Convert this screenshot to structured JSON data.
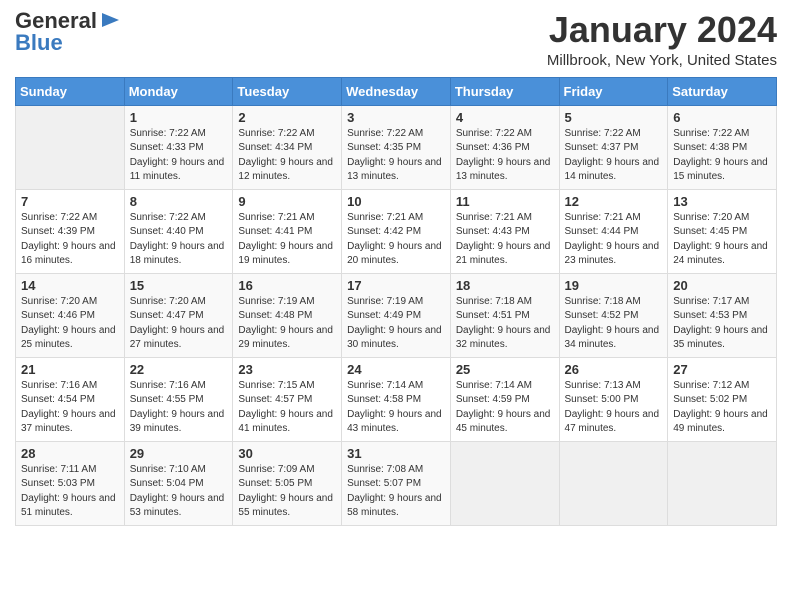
{
  "header": {
    "logo_general": "General",
    "logo_blue": "Blue",
    "month_title": "January 2024",
    "location": "Millbrook, New York, United States"
  },
  "days_of_week": [
    "Sunday",
    "Monday",
    "Tuesday",
    "Wednesday",
    "Thursday",
    "Friday",
    "Saturday"
  ],
  "weeks": [
    [
      {
        "num": "",
        "empty": true
      },
      {
        "num": "1",
        "sunrise": "7:22 AM",
        "sunset": "4:33 PM",
        "daylight": "9 hours and 11 minutes."
      },
      {
        "num": "2",
        "sunrise": "7:22 AM",
        "sunset": "4:34 PM",
        "daylight": "9 hours and 12 minutes."
      },
      {
        "num": "3",
        "sunrise": "7:22 AM",
        "sunset": "4:35 PM",
        "daylight": "9 hours and 13 minutes."
      },
      {
        "num": "4",
        "sunrise": "7:22 AM",
        "sunset": "4:36 PM",
        "daylight": "9 hours and 13 minutes."
      },
      {
        "num": "5",
        "sunrise": "7:22 AM",
        "sunset": "4:37 PM",
        "daylight": "9 hours and 14 minutes."
      },
      {
        "num": "6",
        "sunrise": "7:22 AM",
        "sunset": "4:38 PM",
        "daylight": "9 hours and 15 minutes."
      }
    ],
    [
      {
        "num": "7",
        "sunrise": "7:22 AM",
        "sunset": "4:39 PM",
        "daylight": "9 hours and 16 minutes."
      },
      {
        "num": "8",
        "sunrise": "7:22 AM",
        "sunset": "4:40 PM",
        "daylight": "9 hours and 18 minutes."
      },
      {
        "num": "9",
        "sunrise": "7:21 AM",
        "sunset": "4:41 PM",
        "daylight": "9 hours and 19 minutes."
      },
      {
        "num": "10",
        "sunrise": "7:21 AM",
        "sunset": "4:42 PM",
        "daylight": "9 hours and 20 minutes."
      },
      {
        "num": "11",
        "sunrise": "7:21 AM",
        "sunset": "4:43 PM",
        "daylight": "9 hours and 21 minutes."
      },
      {
        "num": "12",
        "sunrise": "7:21 AM",
        "sunset": "4:44 PM",
        "daylight": "9 hours and 23 minutes."
      },
      {
        "num": "13",
        "sunrise": "7:20 AM",
        "sunset": "4:45 PM",
        "daylight": "9 hours and 24 minutes."
      }
    ],
    [
      {
        "num": "14",
        "sunrise": "7:20 AM",
        "sunset": "4:46 PM",
        "daylight": "9 hours and 25 minutes."
      },
      {
        "num": "15",
        "sunrise": "7:20 AM",
        "sunset": "4:47 PM",
        "daylight": "9 hours and 27 minutes."
      },
      {
        "num": "16",
        "sunrise": "7:19 AM",
        "sunset": "4:48 PM",
        "daylight": "9 hours and 29 minutes."
      },
      {
        "num": "17",
        "sunrise": "7:19 AM",
        "sunset": "4:49 PM",
        "daylight": "9 hours and 30 minutes."
      },
      {
        "num": "18",
        "sunrise": "7:18 AM",
        "sunset": "4:51 PM",
        "daylight": "9 hours and 32 minutes."
      },
      {
        "num": "19",
        "sunrise": "7:18 AM",
        "sunset": "4:52 PM",
        "daylight": "9 hours and 34 minutes."
      },
      {
        "num": "20",
        "sunrise": "7:17 AM",
        "sunset": "4:53 PM",
        "daylight": "9 hours and 35 minutes."
      }
    ],
    [
      {
        "num": "21",
        "sunrise": "7:16 AM",
        "sunset": "4:54 PM",
        "daylight": "9 hours and 37 minutes."
      },
      {
        "num": "22",
        "sunrise": "7:16 AM",
        "sunset": "4:55 PM",
        "daylight": "9 hours and 39 minutes."
      },
      {
        "num": "23",
        "sunrise": "7:15 AM",
        "sunset": "4:57 PM",
        "daylight": "9 hours and 41 minutes."
      },
      {
        "num": "24",
        "sunrise": "7:14 AM",
        "sunset": "4:58 PM",
        "daylight": "9 hours and 43 minutes."
      },
      {
        "num": "25",
        "sunrise": "7:14 AM",
        "sunset": "4:59 PM",
        "daylight": "9 hours and 45 minutes."
      },
      {
        "num": "26",
        "sunrise": "7:13 AM",
        "sunset": "5:00 PM",
        "daylight": "9 hours and 47 minutes."
      },
      {
        "num": "27",
        "sunrise": "7:12 AM",
        "sunset": "5:02 PM",
        "daylight": "9 hours and 49 minutes."
      }
    ],
    [
      {
        "num": "28",
        "sunrise": "7:11 AM",
        "sunset": "5:03 PM",
        "daylight": "9 hours and 51 minutes."
      },
      {
        "num": "29",
        "sunrise": "7:10 AM",
        "sunset": "5:04 PM",
        "daylight": "9 hours and 53 minutes."
      },
      {
        "num": "30",
        "sunrise": "7:09 AM",
        "sunset": "5:05 PM",
        "daylight": "9 hours and 55 minutes."
      },
      {
        "num": "31",
        "sunrise": "7:08 AM",
        "sunset": "5:07 PM",
        "daylight": "9 hours and 58 minutes."
      },
      {
        "num": "",
        "empty": true
      },
      {
        "num": "",
        "empty": true
      },
      {
        "num": "",
        "empty": true
      }
    ]
  ]
}
